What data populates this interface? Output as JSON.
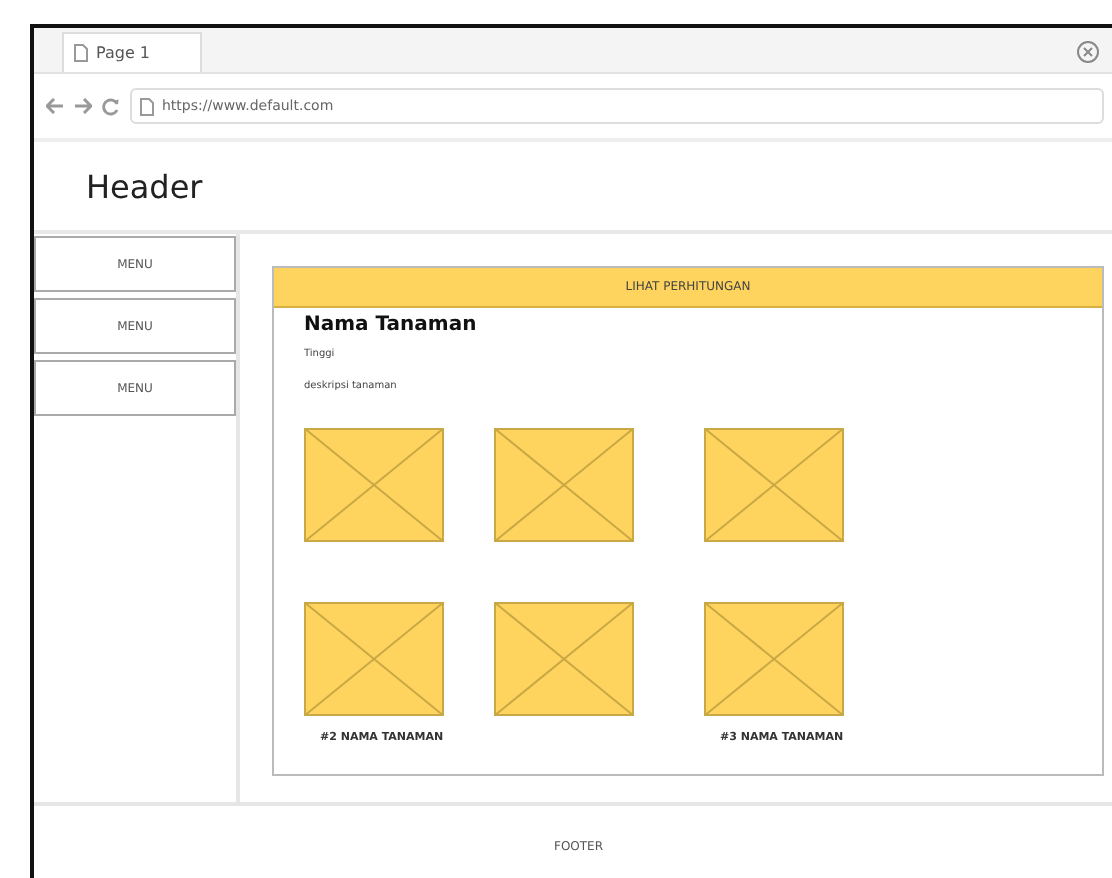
{
  "browser": {
    "tab_title": "Page 1",
    "address": "https://www.default.com"
  },
  "header": {
    "title": "Header"
  },
  "sidebar": {
    "items": [
      {
        "label": "MENU"
      },
      {
        "label": "MENU"
      },
      {
        "label": "MENU"
      }
    ]
  },
  "panel": {
    "banner": "LIHAT PERHITUNGAN",
    "title": "Nama Tanaman",
    "subtitle": "Tinggi",
    "description": "deskripsi tanaman",
    "image_rows": [
      {
        "images": [
          {
            "kind": "placeholder"
          },
          {
            "kind": "placeholder"
          },
          {
            "kind": "placeholder"
          }
        ]
      },
      {
        "images": [
          {
            "kind": "placeholder",
            "caption": "#2 NAMA TANAMAN"
          },
          {
            "kind": "placeholder"
          },
          {
            "kind": "placeholder",
            "caption": "#3 NAMA TANAMAN"
          }
        ]
      }
    ]
  },
  "footer": {
    "text": "FOOTER"
  }
}
